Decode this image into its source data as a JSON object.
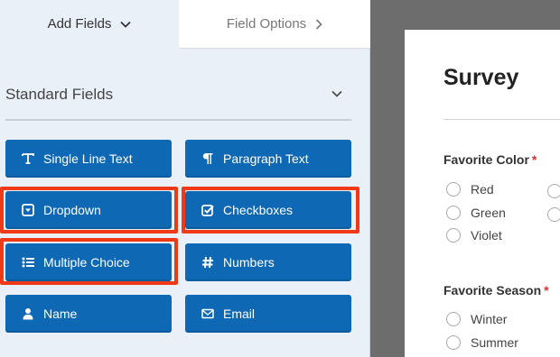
{
  "tabs": {
    "add_fields": "Add Fields",
    "field_options": "Field Options"
  },
  "section": {
    "title": "Standard Fields"
  },
  "fields": [
    {
      "label": "Single Line Text",
      "icon": "text-icon"
    },
    {
      "label": "Paragraph Text",
      "icon": "paragraph-icon"
    },
    {
      "label": "Dropdown",
      "icon": "dropdown-icon"
    },
    {
      "label": "Checkboxes",
      "icon": "checkbox-icon"
    },
    {
      "label": "Multiple Choice",
      "icon": "list-icon"
    },
    {
      "label": "Numbers",
      "icon": "hash-icon"
    },
    {
      "label": "Name",
      "icon": "user-icon"
    },
    {
      "label": "Email",
      "icon": "envelope-icon"
    }
  ],
  "preview": {
    "title": "Survey",
    "questions": [
      {
        "label": "Favorite Color",
        "required_mark": "*",
        "options": [
          "Red",
          "Green",
          "Violet"
        ]
      },
      {
        "label": "Favorite Season",
        "required_mark": "*",
        "options": [
          "Winter",
          "Summer"
        ]
      }
    ]
  },
  "colors": {
    "button_bg": "#0e68b3",
    "highlight": "#f03a17",
    "panel_bg": "#e9f0f7",
    "backdrop": "#6d6d6d"
  }
}
